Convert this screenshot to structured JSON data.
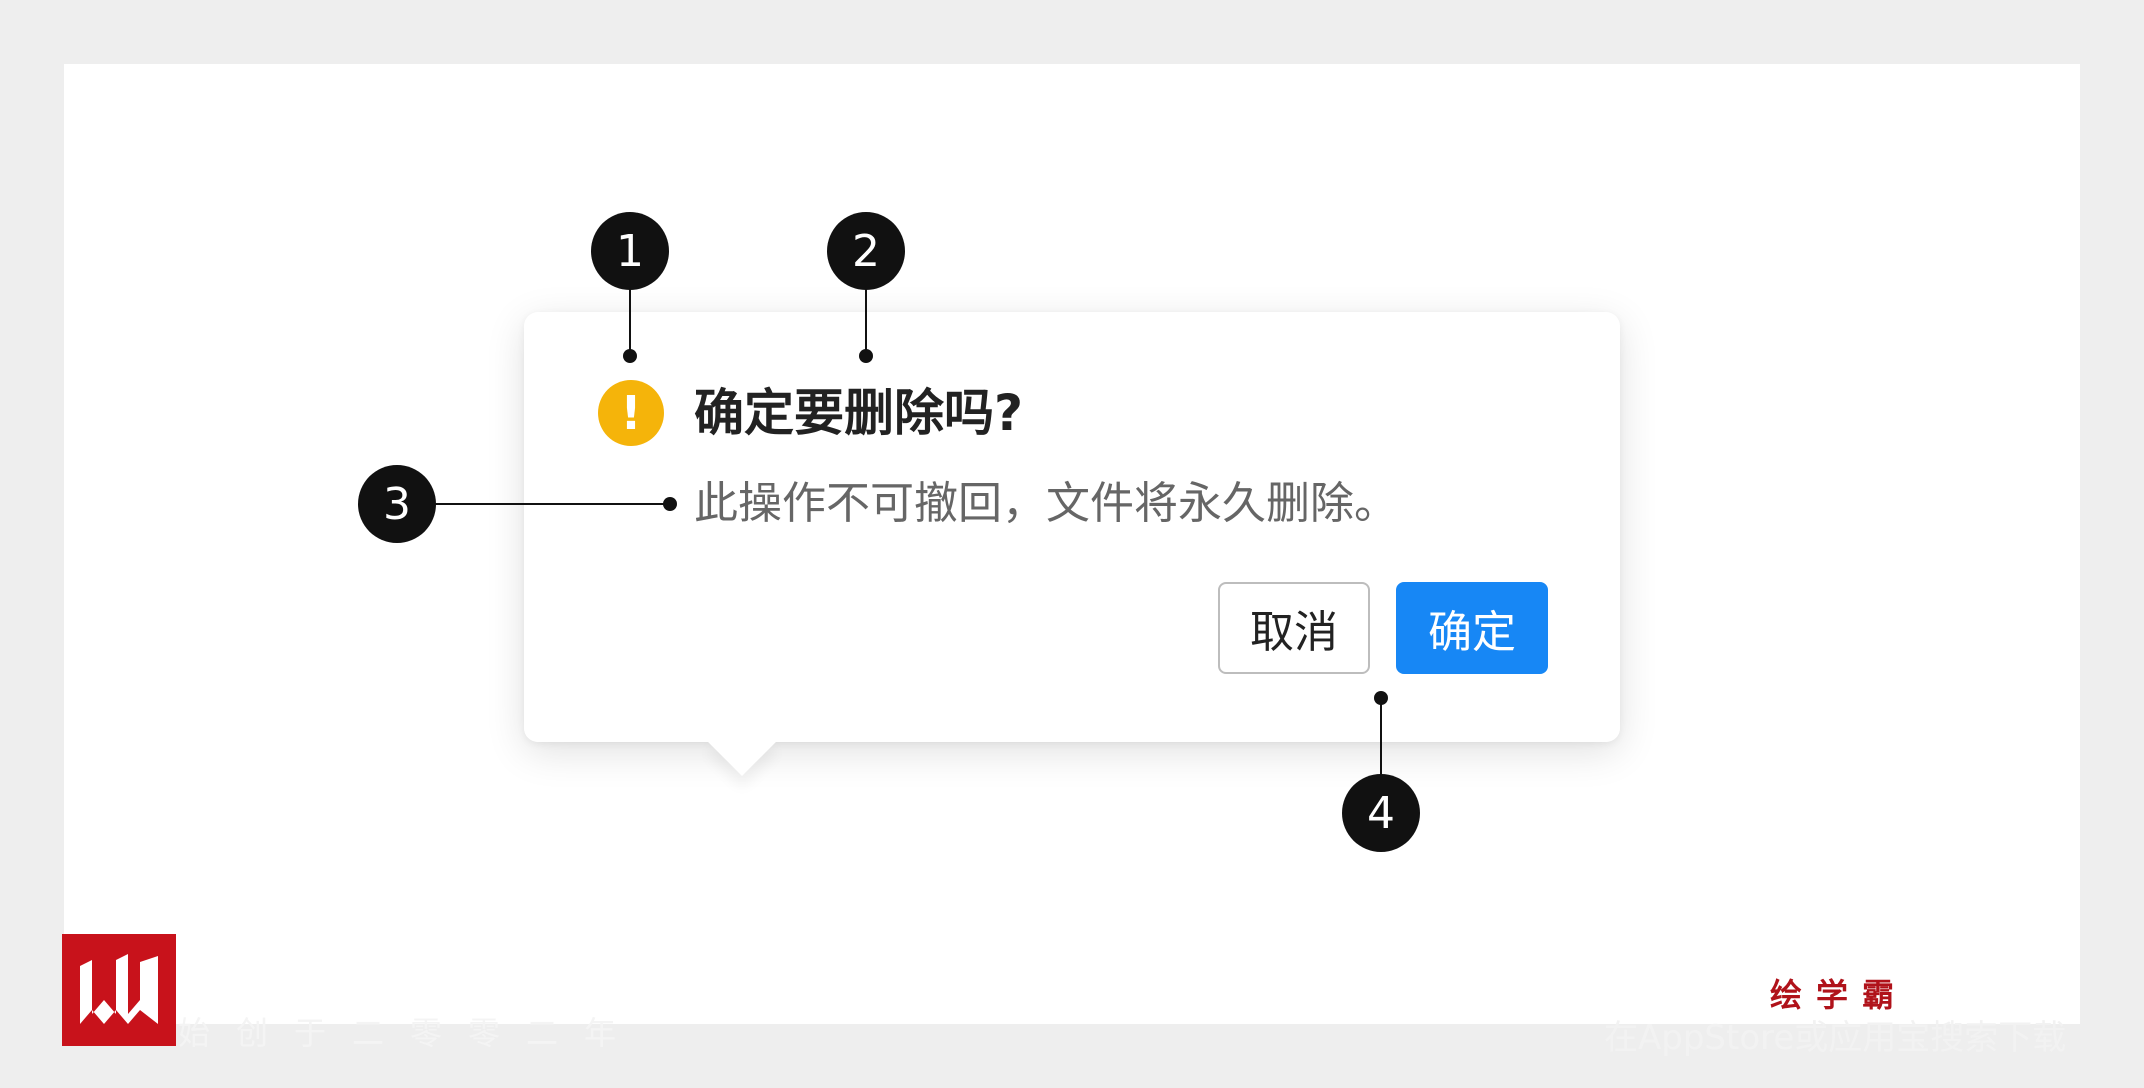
{
  "dialog": {
    "warning_icon": "exclamation-circle-icon",
    "warning_glyph": "!",
    "title": "确定要删除吗?",
    "description": "此操作不可撤回，文件将永久删除。",
    "cancel_label": "取消",
    "confirm_label": "确定"
  },
  "callouts": [
    "1",
    "2",
    "3",
    "4"
  ],
  "watermark": {
    "left_text": "始创于二零零二年",
    "brand": "绘学霸",
    "right_text": "在AppStore或应用宝搜索下载"
  },
  "colors": {
    "warning": "#F5B40A",
    "primary": "#1787F5",
    "brand_red": "#C8121B"
  }
}
